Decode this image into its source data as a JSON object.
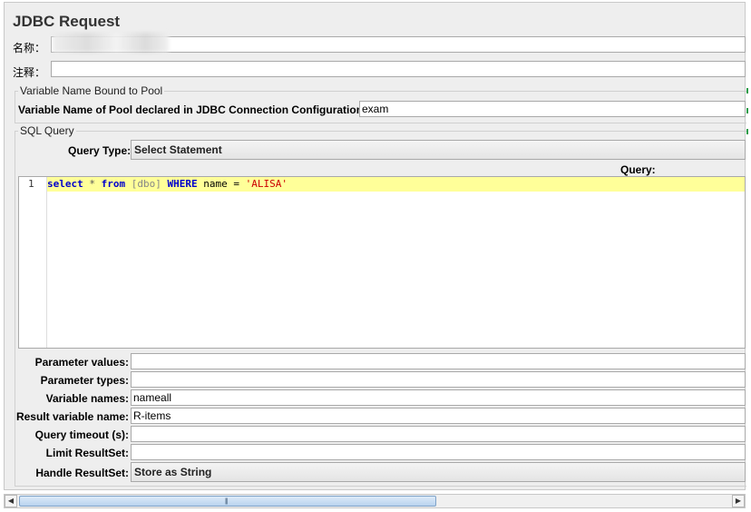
{
  "page": {
    "title": "JDBC Request"
  },
  "general": {
    "name_label": "名称：",
    "name_value": "",
    "comment_label": "注释：",
    "comment_value": ""
  },
  "pool_group": {
    "title": "Variable Name Bound to Pool",
    "pool_label": "Variable Name of Pool declared in JDBC Connection Configuration:",
    "pool_value": "exam"
  },
  "sql_group": {
    "title": "SQL Query",
    "query_type_label": "Query Type:",
    "query_type_value": "Select Statement",
    "query_label": "Query:",
    "line_number": "1",
    "code": {
      "select": "select",
      "star": " * ",
      "from": "from",
      "schema": " [dbo] ",
      "where": "WHERE",
      "name": " name = ",
      "value": "'ALISA'"
    }
  },
  "params": {
    "param_values_label": "Parameter values:",
    "param_values": "",
    "param_types_label": "Parameter types:",
    "param_types": "",
    "variable_names_label": "Variable names:",
    "variable_names": "nameall",
    "result_var_label": "Result variable name:",
    "result_var": "R-items",
    "timeout_label": "Query timeout (s):",
    "timeout": "",
    "limit_label": "Limit ResultSet:",
    "limit": "",
    "handle_label": "Handle ResultSet:",
    "handle_value": "Store as String"
  },
  "scrollbar": {
    "left_arrow": "◀",
    "right_arrow": "▶",
    "grip": "|||"
  },
  "colors": {
    "keyword": "#0000cc",
    "string": "#cc0000",
    "highlight": "#ffff99"
  }
}
